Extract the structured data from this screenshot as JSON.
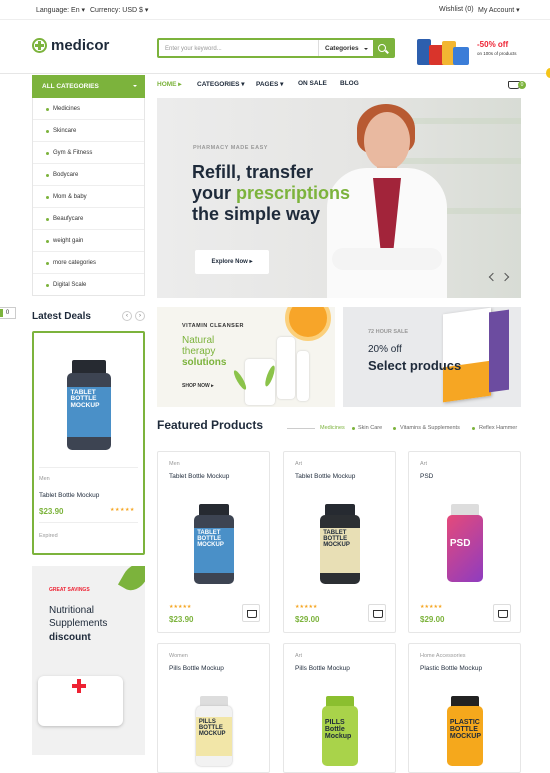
{
  "topbar": {
    "language": "Language: En",
    "currency": "Currency: USD $",
    "wishlist": "Wishlist (0)",
    "account": "My Account"
  },
  "header": {
    "logo": "medicor",
    "search_placeholder": "Enter your keyword...",
    "search_category": "Categories",
    "promo_discount": "-50% off",
    "promo_sub": "on 100s of products"
  },
  "sidebar": {
    "title": "ALL CATEGORIES",
    "items": [
      "Medicines",
      "Skincare",
      "Gym & Fitness",
      "Bodycare",
      "Mom & baby",
      "Beaufycare",
      "weight gain",
      "more categories",
      "Digital Scale"
    ]
  },
  "nav": {
    "items": [
      "HOME",
      "CATEGORIES",
      "PAGES",
      "ON SALE",
      "BLOG"
    ],
    "cart_count": "0"
  },
  "hero": {
    "kicker": "PHARMACY MADE EASY",
    "line1": "Refill, transfer",
    "line2a": "your ",
    "line2b": "prescriptions",
    "line3": "the simple way",
    "button": "Explore Now"
  },
  "banner1": {
    "kicker": "VITAMIN CLEANSER",
    "title1": "Natural",
    "title2": "therapy",
    "title3": "solutions",
    "shop": "SHOP NOW"
  },
  "banner2": {
    "kicker": "72 HOUR SALE",
    "off": "20% off",
    "title": "Select producs"
  },
  "side_tab": "0",
  "deals": {
    "title": "Latest Deals",
    "card": {
      "category": "Men",
      "name": "Tablet Bottle Mockup",
      "price": "$23.90",
      "rating_stars": "★★★★★",
      "status": "Expired",
      "bottle_label": "TABLET BOTTLE MOCKUP"
    }
  },
  "savings": {
    "kicker": "GREAT SAVINGS",
    "line1": "Nutritional",
    "line2": "Supplements",
    "line3": "discount"
  },
  "featured": {
    "title": "Featured Products",
    "tabs": [
      "Medicines",
      "Skin Care",
      "Vitamins & Supplements",
      "Reflex Hammer"
    ],
    "products": [
      {
        "category": "Men",
        "name": "Tablet Bottle Mockup",
        "price": "$23.90",
        "stars": "★★★★★",
        "label": "TABLET BOTTLE MOCKUP",
        "color": "#4a90c8"
      },
      {
        "category": "Art",
        "name": "Tablet Bottle Mockup",
        "price": "$29.00",
        "stars": "★★★★★",
        "label": "TABLET BOTTLE MOCKUP",
        "color": "#e8dfb5"
      },
      {
        "category": "Art",
        "name": "PSD",
        "price": "$29.00",
        "stars": "★★★★★",
        "label": "PSD",
        "color": "#c03a8f"
      },
      {
        "category": "Women",
        "name": "Pills Bottle Mockup",
        "price": "",
        "stars": "",
        "label": "PILLS BOTTLE MOCKUP",
        "color": "#f2e6a8"
      },
      {
        "category": "Art",
        "name": "Pills Bottle Mockup",
        "price": "",
        "stars": "",
        "label": "PILLS Bottle Mockup",
        "color": "#a9d34a"
      },
      {
        "category": "Home Accessories",
        "name": "Plastic Bottle Mockup",
        "price": "",
        "stars": "",
        "label": "PLASTIC BOTTLE MOCKUP",
        "color": "#f5a81c"
      }
    ]
  }
}
